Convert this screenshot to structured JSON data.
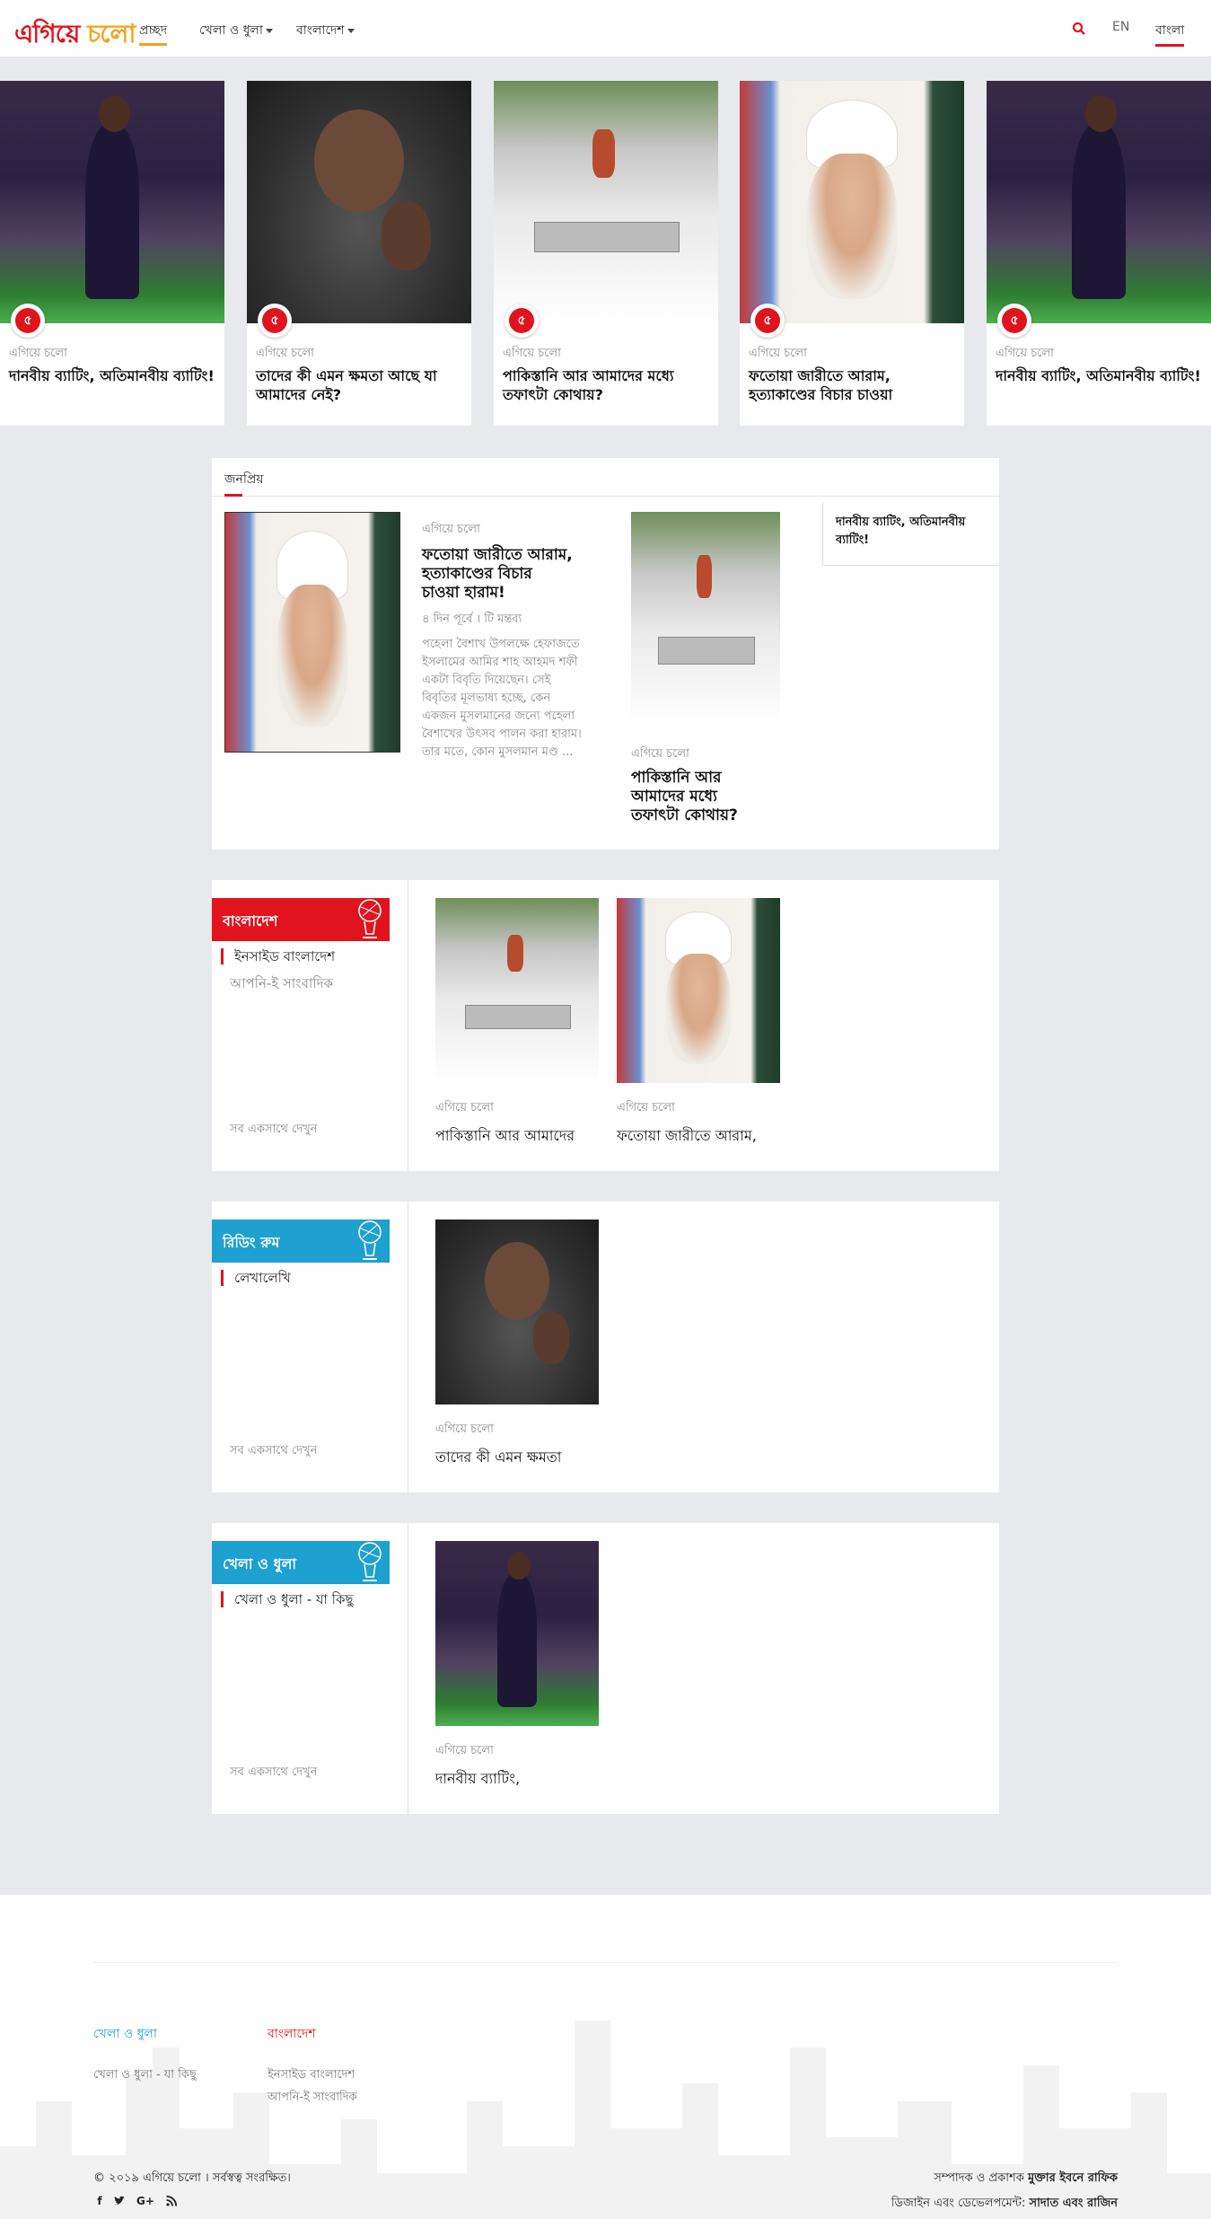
{
  "header": {
    "logo_part1": "এগিয়ে",
    "logo_part2": "চলো",
    "nav": [
      "প্রচ্ছদ",
      "খেলা ও ধুলা",
      "বাংলাদেশ"
    ],
    "lang_en": "EN",
    "lang_bn": "বাংলা"
  },
  "carousel": [
    {
      "source": "এগিয়ে চলো",
      "title": "দানবীয় ব্যাটিং, অতিমানবীয় ব্যাটিং!",
      "image": "cricketer-photo"
    },
    {
      "source": "এগিয়ে চলো",
      "title": "তাদের কী এমন ক্ষমতা আছে যা আমাদের নেই?",
      "image": "boy-photo"
    },
    {
      "source": "এগিয়ে চলো",
      "title": "পাকিস্তানি আর আমাদের মধ্যে তফাৎটা কোথায়?",
      "image": "memorial-photo"
    },
    {
      "source": "এগিয়ে চলো",
      "title": "ফতোয়া জারীতে আরাম, হত্যাকাণ্ডের বিচার চাওয়া",
      "image": "cleric-photo"
    },
    {
      "source": "এগিয়ে চলো",
      "title": "দানবীয় ব্যাটিং, অতিমানবীয় ব্যাটিং!",
      "image": "cricketer-photo"
    }
  ],
  "carousel_badge": "৫",
  "popular": {
    "heading": "জনপ্রিয়",
    "lead": {
      "source": "এগিয়ে চলো",
      "title": "ফতোয়া জারীতে আরাম, হত্যাকাণ্ডের বিচার চাওয়া হারাম!",
      "meta": "৪ দিন পূর্বে । টি মন্তব্য",
      "excerpt": "পহেলা বৈশাখ উপলক্ষে হেফাজতে ইসলামের আমির শাহ আহমদ শফী একটা বিবৃতি দিয়েছেন। সেই বিবৃতির মূলভাষ্য হচ্ছে, কেন একজন মুসলমানের জন্যে পহেলা বৈশাখের উৎসব পালন করা হারাম। তার মতে, কোন মুসলমান মণ্ড ..."
    },
    "second": {
      "source": "এগিয়ে চলো",
      "title": "পাকিস্তানি আর আমাদের মধ্যে তফাৎটা কোথায়?"
    },
    "side_title": "দানবীয় ব্যাটিং, অতিমানবীয় ব্যাটিং!"
  },
  "categories": [
    {
      "label": "বাংলাদেশ",
      "color": "#e0141c",
      "sub_active": "ইনসাইড বাংলাদেশ",
      "sub_other": "আপনি-ই সাংবাদিক",
      "see_all": "সব একসাথে দেখুন",
      "cards": [
        {
          "source": "এগিয়ে চলো",
          "title": "পাকিস্তানি আর আমাদের"
        },
        {
          "source": "এগিয়ে চলো",
          "title": "ফতোয়া জারীতে আরাম,"
        }
      ]
    },
    {
      "label": "রিডিং রুম",
      "color": "#1ea0d0",
      "sub_active": "লেখালেখি",
      "see_all": "সব একসাথে দেখুন",
      "cards": [
        {
          "source": "এগিয়ে চলো",
          "title": "তাদের কী এমন ক্ষমতা"
        }
      ]
    },
    {
      "label": "খেলা ও ধুলা",
      "color": "#1ea0d0",
      "sub_active": "খেলা ও ধুলা - যা কিছু",
      "see_all": "সব একসাথে দেখুন",
      "cards": [
        {
          "source": "এগিয়ে চলো",
          "title": "দানবীয় ব্যাটিং,"
        }
      ]
    }
  ],
  "footer": {
    "col1_head": "খেলা ও ধুলা",
    "col1_head_color": "#1ea0d0",
    "col1_links": [
      "খেলা ও ধুলা - যা কিছু"
    ],
    "col2_head": "বাংলাদেশ",
    "col2_head_color": "#e0141c",
    "col2_links": [
      "ইনসাইড বাংলাদেশ",
      "আপনি-ই সাংবাদিক"
    ],
    "copyright": "© ২০১৯ এগিয়ে চলো । সর্বস্বত্ব সংরক্ষিত।",
    "editor_label": "সম্পাদক ও প্রকাশক",
    "editor_name": "মুক্তার ইবনে রাফিক",
    "design_label": "ডিজাইন এবং ডেভেলপমেন্ট:",
    "design_name": "সাদাত এবং রাজিন",
    "social": [
      "facebook-icon",
      "twitter-icon",
      "google-plus-icon",
      "rss-icon"
    ]
  }
}
